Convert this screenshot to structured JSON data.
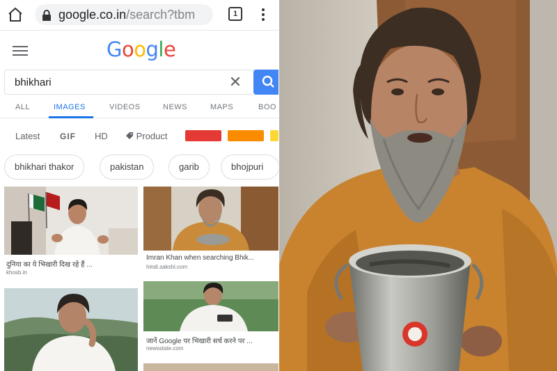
{
  "browser": {
    "url_main": "google.co.in",
    "url_rest": "/search?tbm",
    "tab_count": "1"
  },
  "google": {
    "logo_letters": [
      {
        "ch": "G",
        "color": "#4285F4"
      },
      {
        "ch": "o",
        "color": "#EA4335"
      },
      {
        "ch": "o",
        "color": "#FBBC05"
      },
      {
        "ch": "g",
        "color": "#4285F4"
      },
      {
        "ch": "l",
        "color": "#34A853"
      },
      {
        "ch": "e",
        "color": "#EA4335"
      }
    ],
    "search_query": "bhikhari",
    "accent": "#4285f4"
  },
  "tabs": [
    "ALL",
    "IMAGES",
    "VIDEOS",
    "NEWS",
    "MAPS",
    "BOO"
  ],
  "active_tab": "IMAGES",
  "filters": {
    "latest": "Latest",
    "gif": "GIF",
    "hd": "HD",
    "product": "Product",
    "swatches": [
      "#e53935",
      "#fb8c00",
      "#fdd835"
    ]
  },
  "related": [
    "bhikhari thakor",
    "pakistan",
    "garib",
    "bhojpuri"
  ],
  "results": [
    {
      "caption": "दुनिया का ये भिखारी दिख रहे हैं ...",
      "source": "khosb.in"
    },
    {
      "caption": "Imran Khan when searching Bhik...",
      "source": "hindi.sakshi.com"
    },
    {
      "caption": "",
      "source": ""
    },
    {
      "caption": "जानें Google पर भिखारी सर्च करने पर ...",
      "source": "newsstate.com"
    }
  ],
  "icons": {
    "home": "home-icon",
    "lock": "lock-icon",
    "tabs": "tabs-switcher-icon",
    "menu": "overflow-menu-icon",
    "hamburger": "hamburger-menu-icon",
    "clear": "close-icon",
    "search": "search-icon",
    "tag": "tag-icon"
  }
}
